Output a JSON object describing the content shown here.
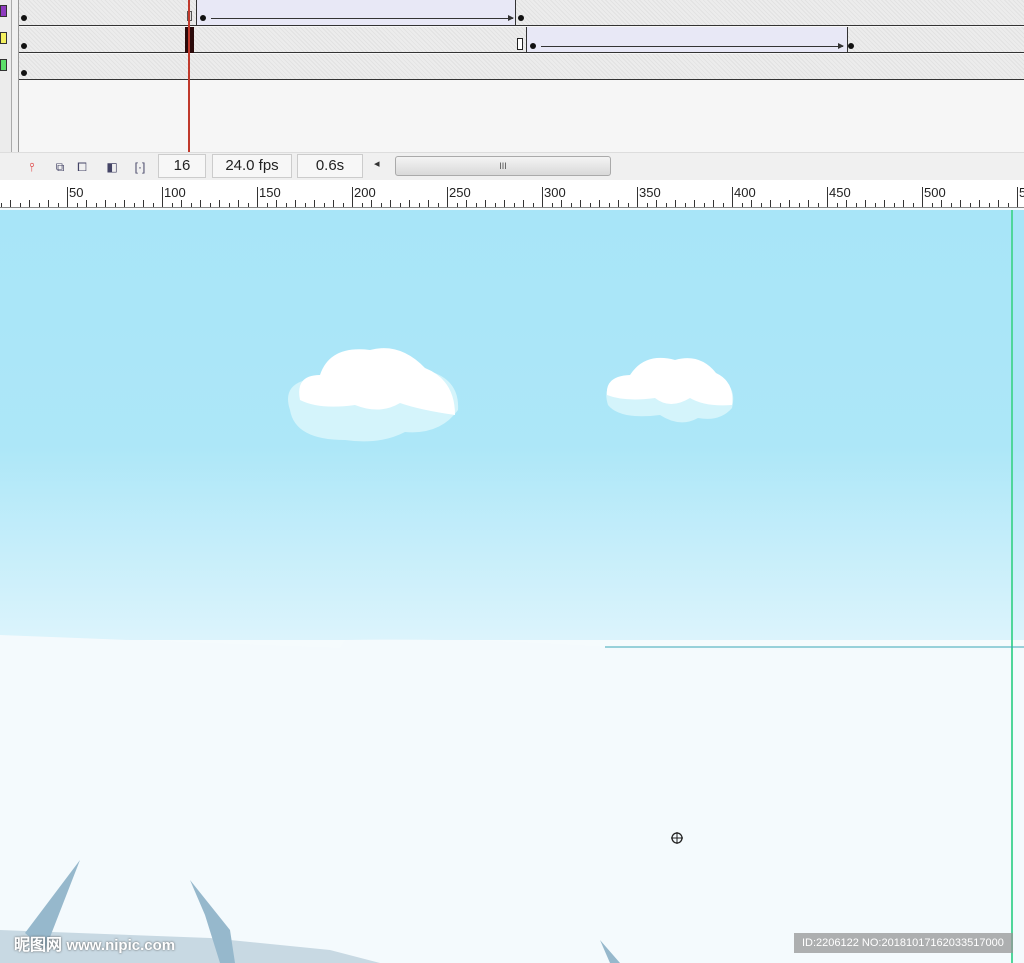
{
  "timeline": {
    "layer_colors": [
      "#8e3bbf",
      "#f4f060",
      "#5de06a"
    ],
    "current_frame": "16",
    "fps": "24.0 fps",
    "elapsed": "0.6s",
    "scroll_left": "◂",
    "scroll_grip": "III"
  },
  "ruler": {
    "labels": [
      "50",
      "100",
      "150",
      "200",
      "250",
      "300",
      "350",
      "400",
      "450",
      "500",
      "5"
    ]
  },
  "watermark": {
    "logo": "昵图网",
    "site": "www.nipic.com",
    "id": "ID:2206122 NO:20181017162033517000"
  },
  "colors": {
    "guide": "#4fd69a",
    "playhead": "#c0392b"
  }
}
